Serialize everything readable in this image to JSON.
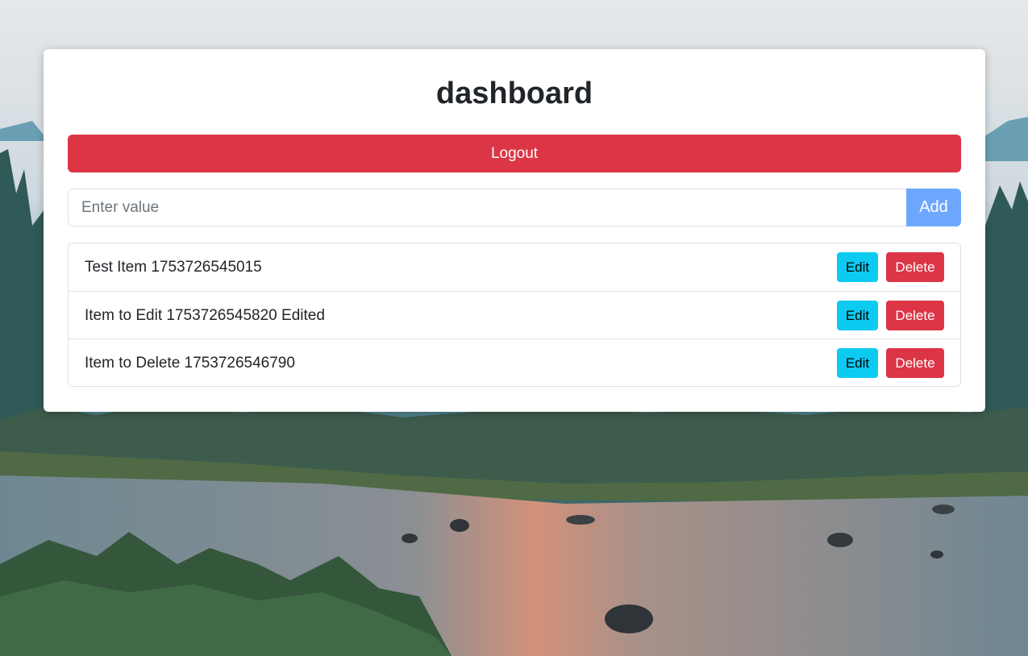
{
  "page": {
    "title": "dashboard"
  },
  "actions": {
    "logout_label": "Logout"
  },
  "add_form": {
    "placeholder": "Enter value",
    "value": "",
    "button_label": "Add"
  },
  "items": [
    {
      "text": "Test Item 1753726545015",
      "edit_label": "Edit",
      "delete_label": "Delete"
    },
    {
      "text": "Item to Edit 1753726545820 Edited",
      "edit_label": "Edit",
      "delete_label": "Delete"
    },
    {
      "text": "Item to Delete 1753726546790",
      "edit_label": "Edit",
      "delete_label": "Delete"
    }
  ],
  "colors": {
    "danger": "#dc3545",
    "info": "#0dcaf0",
    "primary_light": "#6ea8fe",
    "card_bg": "#ffffff",
    "text": "#212529"
  },
  "background": {
    "description_icon": "landscape-river-forest-image"
  }
}
